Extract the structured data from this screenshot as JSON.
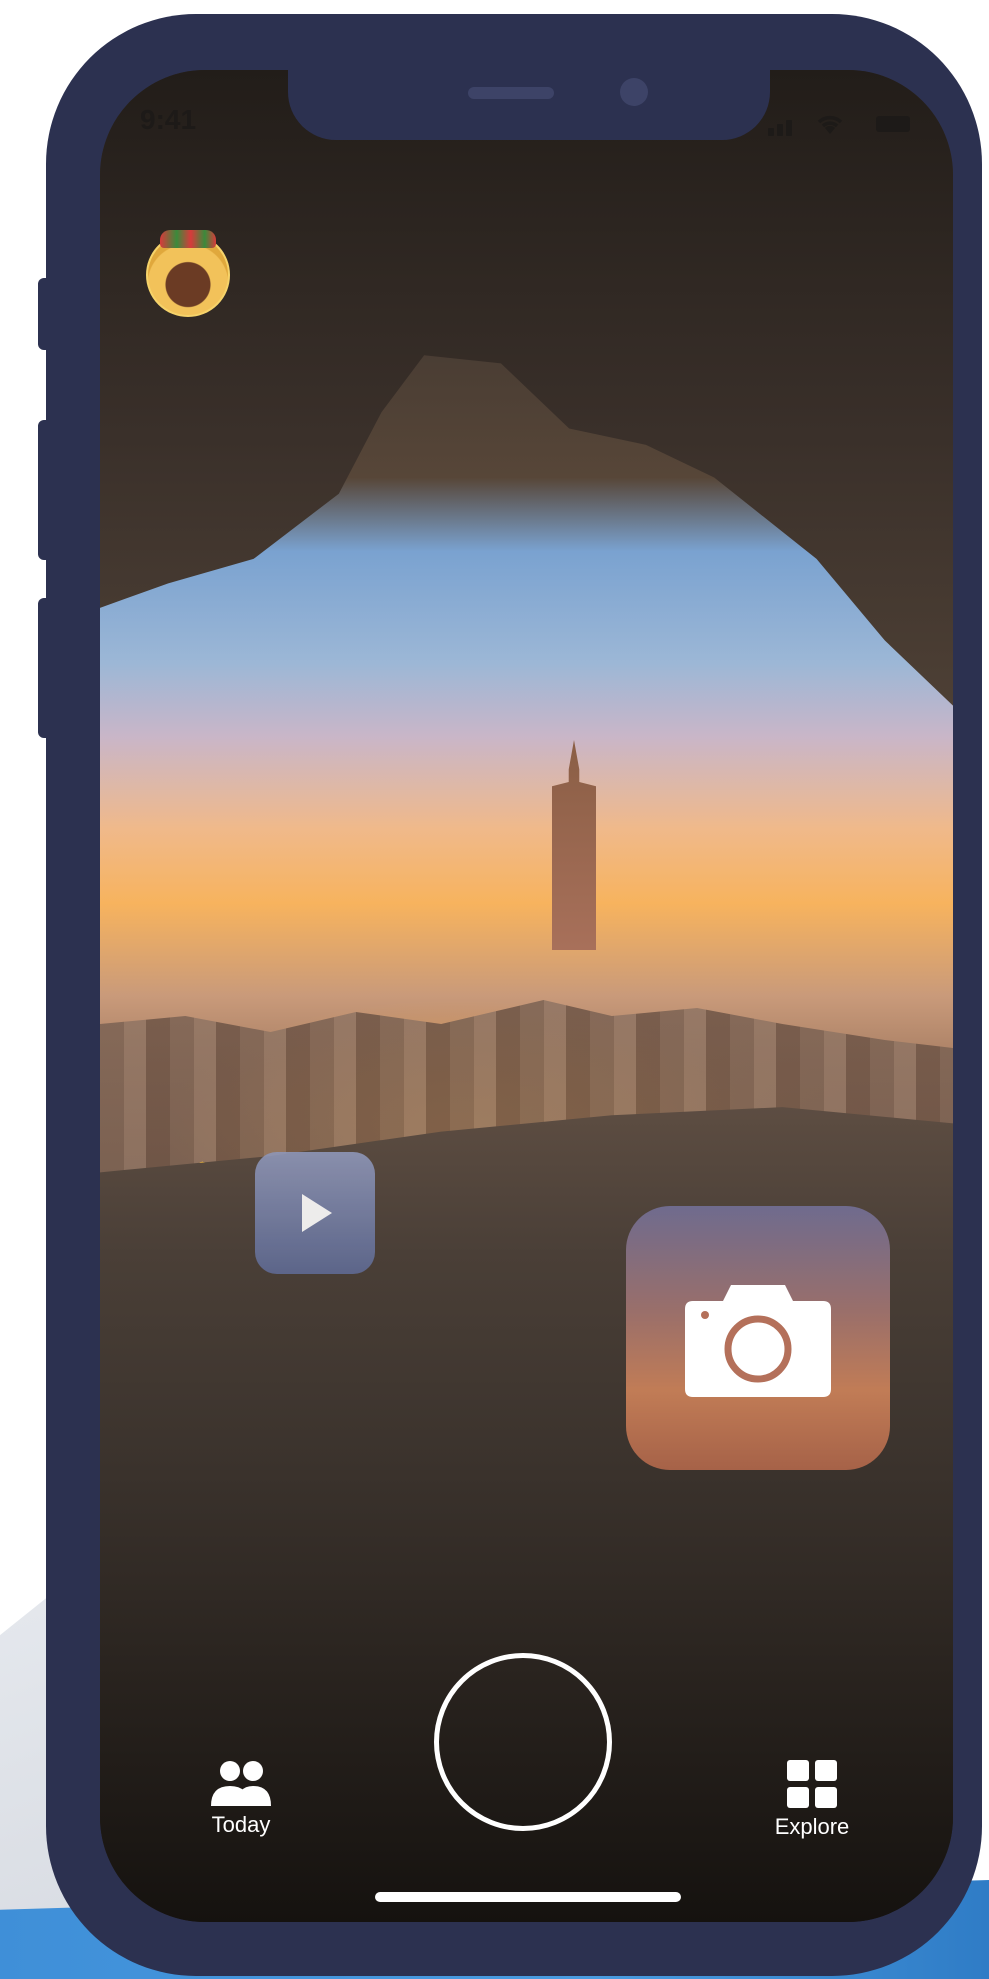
{
  "status_bar": {
    "time": "9:41"
  },
  "icons": {
    "avatar": "avatar",
    "play": "play-icon",
    "camera": "camera-icon",
    "shutter": "shutter-button",
    "today": "people-icon",
    "explore": "grid-icon"
  },
  "tab_bar": {
    "today_label": "Today",
    "explore_label": "Explore"
  },
  "colors": {
    "phone_frame": "#2c3150",
    "accent_blue": "#3f8fd8",
    "tile_play": "#6f7aa3",
    "tile_camera": "#b0705a"
  }
}
